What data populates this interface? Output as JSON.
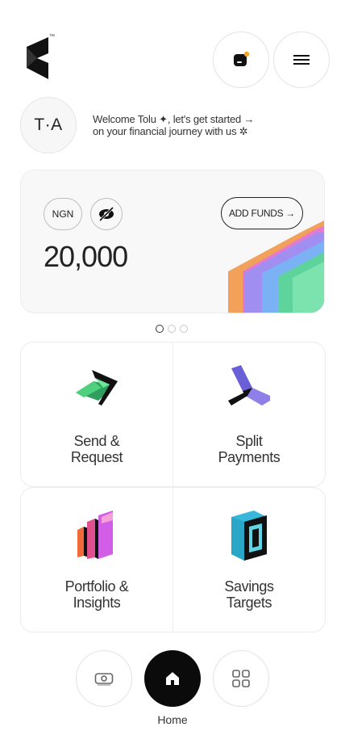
{
  "header": {
    "logo_icon": "brand-k-logo",
    "trademark": "™",
    "notifications_icon": "notification-badge-icon",
    "menu_icon": "hamburger-icon",
    "accent_color": "#f6a623"
  },
  "profile": {
    "initials": "T·A",
    "welcome_line1": "Welcome Tolu ✦, let's get started →",
    "welcome_line2": "on your financial journey with us ✲"
  },
  "balance_card": {
    "currency": "NGN",
    "visibility_icon": "eye-off-icon",
    "add_funds_label": "ADD FUNDS →",
    "balance": "20,000"
  },
  "carousel": {
    "pages": 3,
    "active": 0
  },
  "actions": [
    {
      "line1": "Send &",
      "line2": "Request",
      "icon": "send-arrow-icon"
    },
    {
      "line1": "Split",
      "line2": "Payments",
      "icon": "split-icon"
    },
    {
      "line1": "Portfolio &",
      "line2": "Insights",
      "icon": "portfolio-bars-icon"
    },
    {
      "line1": "Savings",
      "line2": "Targets",
      "icon": "target-box-icon"
    }
  ],
  "bottom_nav": {
    "left_icon": "wallet-cash-icon",
    "center_icon": "home-icon",
    "center_label": "Home",
    "right_icon": "grid-apps-icon"
  }
}
